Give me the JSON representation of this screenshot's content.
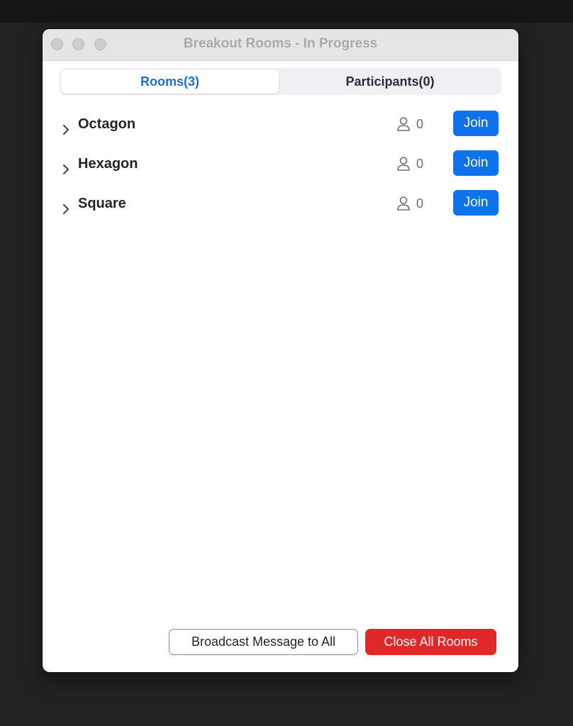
{
  "window": {
    "title": "Breakout Rooms - In Progress"
  },
  "tabs": [
    {
      "label": "Rooms(3)",
      "active": true
    },
    {
      "label": "Participants(0)",
      "active": false
    }
  ],
  "rooms": [
    {
      "name": "Octagon",
      "count": "0",
      "join_label": "Join"
    },
    {
      "name": "Hexagon",
      "count": "0",
      "join_label": "Join"
    },
    {
      "name": "Square",
      "count": "0",
      "join_label": "Join"
    }
  ],
  "icons": {
    "expand": "chevron-right-icon",
    "participants": "person-icon"
  },
  "footer": {
    "broadcast_label": "Broadcast Message to All",
    "close_all_label": "Close All Rooms"
  },
  "colors": {
    "accent": "#0e72ec",
    "active_tab": "#1a6fd9",
    "danger": "#e02828"
  }
}
